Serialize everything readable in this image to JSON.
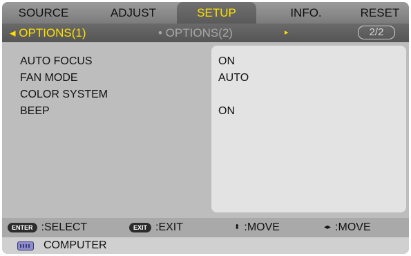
{
  "tabs": [
    {
      "label": "SOURCE"
    },
    {
      "label": "ADJUST"
    },
    {
      "label": "SETUP",
      "active": true
    },
    {
      "label": "INFO."
    },
    {
      "label": "RESET"
    }
  ],
  "subtabs": {
    "active_label": "◂ OPTIONS(1)",
    "inactive_label": "• OPTIONS(2)",
    "next_arrow": "▸",
    "page": "2/2"
  },
  "settings": [
    {
      "label": "AUTO FOCUS",
      "value": "ON"
    },
    {
      "label": "FAN MODE",
      "value": "AUTO"
    },
    {
      "label": "COLOR SYSTEM",
      "value": ""
    },
    {
      "label": "BEEP",
      "value": "ON"
    }
  ],
  "footer": {
    "enter_key": "ENTER",
    "enter_label": ":SELECT",
    "exit_key": "EXIT",
    "exit_label": ":EXIT",
    "move_vertical_icon": "⬍",
    "move_vertical_label": ":MOVE",
    "move_horizontal_icon": "◂▸",
    "move_horizontal_label": ":MOVE"
  },
  "status": {
    "source_icon": "computer-icon",
    "source_label": "COMPUTER"
  },
  "colors": {
    "active_tab_text": "#ffe000",
    "panel_bg": "#bdbdbd",
    "value_panel_bg": "#e3e3e3"
  }
}
